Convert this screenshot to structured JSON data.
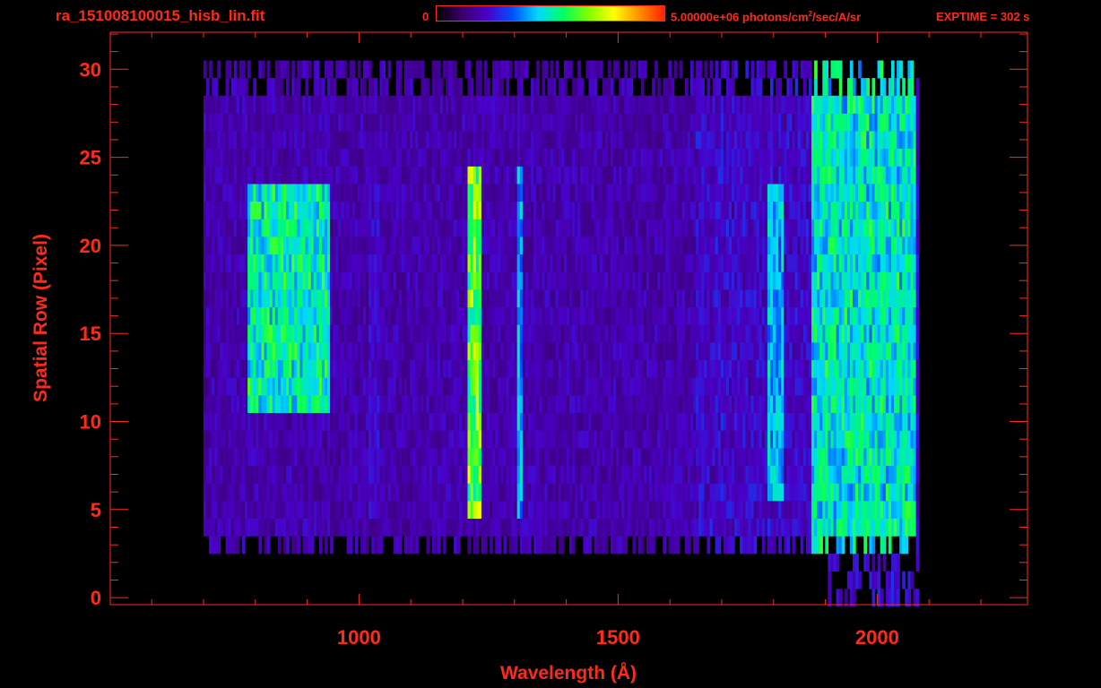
{
  "header": {
    "filename": "ra_151008100015_hisb_lin.fit",
    "colorbar_min": "0",
    "colorbar_max_prefix": "5.00000e+06 photons/cm",
    "colorbar_max_exp": "2",
    "colorbar_max_suffix": "/sec/A/sr",
    "exptime": "EXPTIME = 302 s"
  },
  "colors": {
    "axis": "#ff2a1a",
    "background": "#000000",
    "colormap": [
      "#000000",
      "#3a006a",
      "#4a00c8",
      "#0050ff",
      "#00d8ff",
      "#00ff60",
      "#80ff00",
      "#ffff00",
      "#ff9000",
      "#ff2000"
    ]
  },
  "chart_data": {
    "type": "heatmap",
    "xlabel": "Wavelength (Å)",
    "ylabel": "Spatial Row (Pixel)",
    "xlim": [
      520,
      2290
    ],
    "ylim": [
      -0.4,
      32.1
    ],
    "x_ticks": [
      1000,
      1500,
      2000
    ],
    "y_ticks": [
      0,
      5,
      10,
      15,
      20,
      25,
      30
    ],
    "colorbar_range": [
      0,
      5000000
    ],
    "colorbar_units": "photons/cm^2/sec/A/sr",
    "rows": [
      0,
      30
    ],
    "wavelength_range": [
      700,
      2080
    ],
    "features": [
      {
        "x_start": 780,
        "x_end": 940,
        "rows": [
          11,
          23
        ],
        "level": 0.5
      },
      {
        "x_start": 1018,
        "x_end": 1038,
        "rows": [
          5,
          23
        ],
        "level": 0.22
      },
      {
        "x_start": 1205,
        "x_end": 1235,
        "rows": [
          5,
          24
        ],
        "level": 0.62
      },
      {
        "x_start": 1300,
        "x_end": 1315,
        "rows": [
          5,
          24
        ],
        "level": 0.4
      },
      {
        "x_start": 1785,
        "x_end": 1815,
        "rows": [
          6,
          23
        ],
        "level": 0.38
      },
      {
        "x_start": 1870,
        "x_end": 2070,
        "rows": [
          3,
          30
        ],
        "level": 0.45
      }
    ]
  }
}
